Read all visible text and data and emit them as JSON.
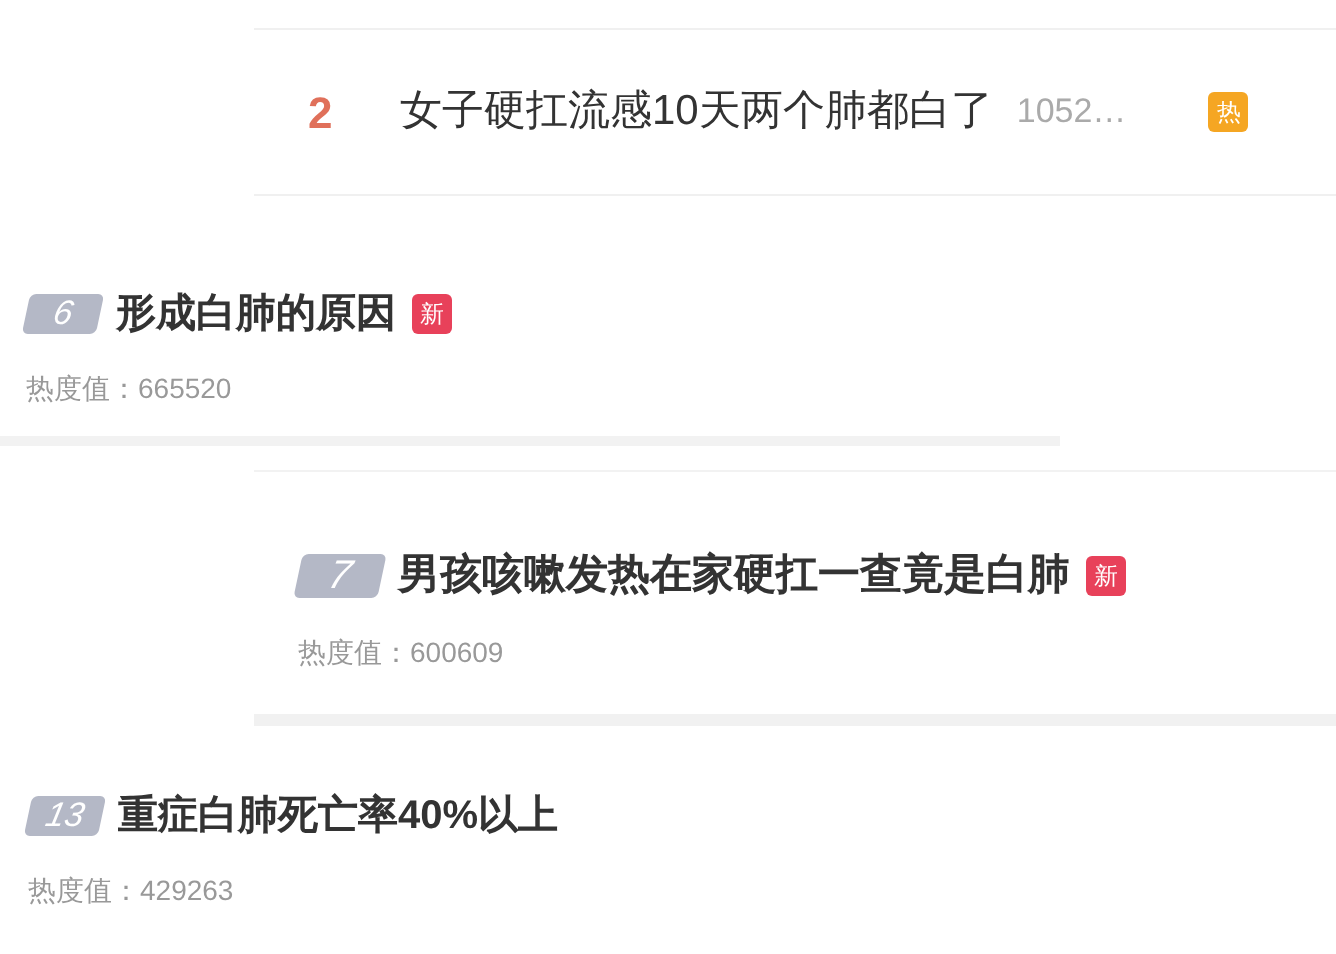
{
  "fragments": [
    {
      "kind": "inline",
      "rank": "2",
      "title": "女子硬扛流感10天两个肺都白了",
      "heat": "1052…",
      "badge": {
        "kind": "hot",
        "label": "热"
      }
    },
    {
      "kind": "card",
      "rank": "6",
      "title": "形成白肺的原因",
      "badge": {
        "kind": "new",
        "label": "新"
      },
      "heat_label": "热度值：",
      "heat": "665520"
    },
    {
      "kind": "card",
      "rank": "7",
      "title": "男孩咳嗽发热在家硬扛一查竟是白肺",
      "badge": {
        "kind": "new",
        "label": "新"
      },
      "heat_label": "热度值：",
      "heat": "600609"
    },
    {
      "kind": "card",
      "rank": "13",
      "title": "重症白肺死亡率40%以上",
      "heat_label": "热度值：",
      "heat": "429263"
    }
  ]
}
